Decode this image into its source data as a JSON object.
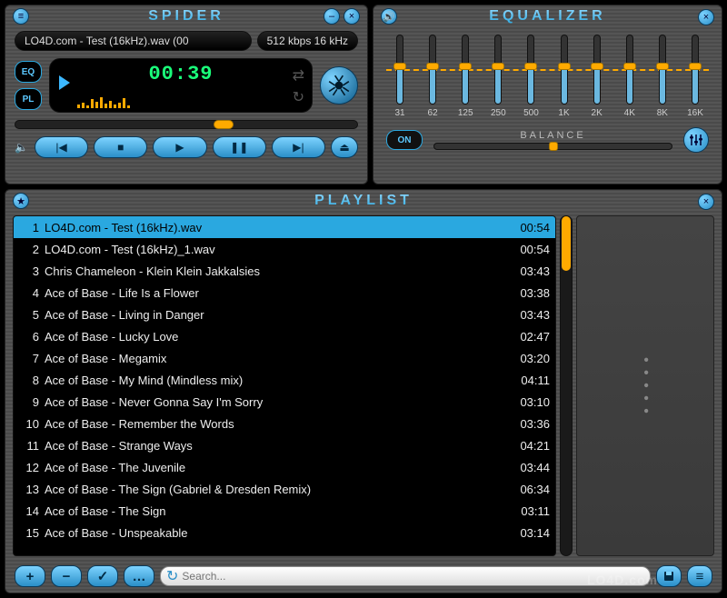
{
  "player": {
    "title": "SPIDER",
    "track_name": "LO4D.com - Test (16kHz).wav (00",
    "bitrate_info": "512 kbps 16 kHz",
    "eq_button": "EQ",
    "pl_button": "PL",
    "time": "00:39",
    "viz_heights": [
      4,
      6,
      3,
      10,
      7,
      12,
      5,
      8,
      4,
      6,
      11,
      3
    ],
    "seek_pct": 58
  },
  "equalizer": {
    "title": "EQUALIZER",
    "bands": [
      {
        "label": "31",
        "value": 55
      },
      {
        "label": "62",
        "value": 55
      },
      {
        "label": "125",
        "value": 55
      },
      {
        "label": "250",
        "value": 55
      },
      {
        "label": "500",
        "value": 55
      },
      {
        "label": "1K",
        "value": 55
      },
      {
        "label": "2K",
        "value": 55
      },
      {
        "label": "4K",
        "value": 55
      },
      {
        "label": "8K",
        "value": 55
      },
      {
        "label": "16K",
        "value": 55
      }
    ],
    "on_label": "ON",
    "balance_label": "BALANCE",
    "balance_pct": 50
  },
  "playlist": {
    "title": "PLAYLIST",
    "items": [
      {
        "n": 1,
        "title": "LO4D.com - Test (16kHz).wav",
        "dur": "00:54",
        "selected": true
      },
      {
        "n": 2,
        "title": "LO4D.com - Test (16kHz)_1.wav",
        "dur": "00:54"
      },
      {
        "n": 3,
        "title": "Chris Chameleon - Klein Klein Jakkalsies",
        "dur": "03:43"
      },
      {
        "n": 4,
        "title": "Ace of Base - Life Is a Flower",
        "dur": "03:38"
      },
      {
        "n": 5,
        "title": "Ace of Base - Living in Danger",
        "dur": "03:43"
      },
      {
        "n": 6,
        "title": "Ace of Base - Lucky Love",
        "dur": "02:47"
      },
      {
        "n": 7,
        "title": "Ace of Base - Megamix",
        "dur": "03:20"
      },
      {
        "n": 8,
        "title": "Ace of Base - My Mind (Mindless mix)",
        "dur": "04:11"
      },
      {
        "n": 9,
        "title": "Ace of Base - Never Gonna Say I'm Sorry",
        "dur": "03:10"
      },
      {
        "n": 10,
        "title": "Ace of Base - Remember the Words",
        "dur": "03:36"
      },
      {
        "n": 11,
        "title": "Ace of Base - Strange Ways",
        "dur": "04:21"
      },
      {
        "n": 12,
        "title": "Ace of Base - The Juvenile",
        "dur": "03:44"
      },
      {
        "n": 13,
        "title": "Ace of Base - The Sign (Gabriel & Dresden Remix)",
        "dur": "06:34"
      },
      {
        "n": 14,
        "title": "Ace of Base - The Sign",
        "dur": "03:11"
      },
      {
        "n": 15,
        "title": "Ace of Base - Unspeakable",
        "dur": "03:14"
      }
    ],
    "search_placeholder": "Search...",
    "watermark": "LO4D.com"
  }
}
